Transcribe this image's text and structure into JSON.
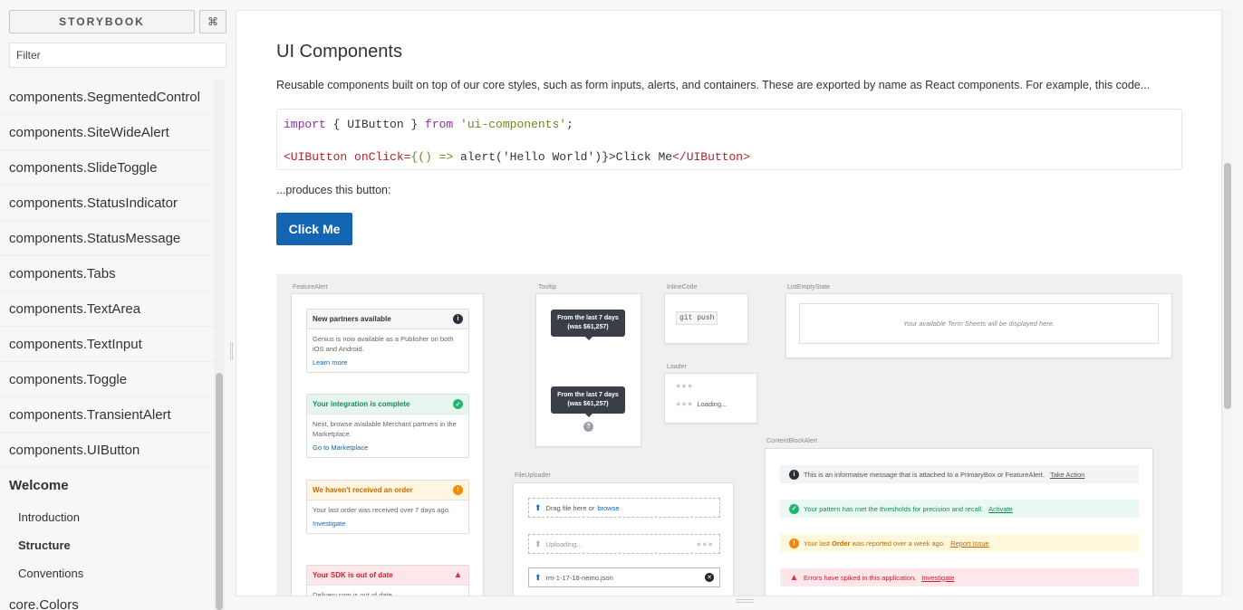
{
  "sidebar": {
    "title": "STORYBOOK",
    "shortcut_icon": "⌘",
    "filter_placeholder": "Filter",
    "components": [
      "components.SegmentedControl",
      "components.SiteWideAlert",
      "components.SlideToggle",
      "components.StatusIndicator",
      "components.StatusMessage",
      "components.Tabs",
      "components.TextArea",
      "components.TextInput",
      "components.Toggle",
      "components.TransientAlert",
      "components.UIButton"
    ],
    "kind_welcome": "Welcome",
    "stories": [
      "Introduction",
      "Structure",
      "Conventions"
    ],
    "active_story": "Structure",
    "kind_next": "core.Colors"
  },
  "main": {
    "title": "UI Components",
    "description": "Reusable components built on top of our core styles, such as form inputs, alerts, and containers. These are exported by name as React components. For example, this code...",
    "code": {
      "line1_kw1": "import",
      "line1_mid": " { UIButton } ",
      "line1_kw2": "from",
      "line1_str": " 'ui-components'",
      "line1_end": ";",
      "line2_tag_open": "<UIButton",
      "line2_attr": " onClick=",
      "line2_brace": "{() => ",
      "line2_body": "alert('Hello World')}",
      "line2_close": ">Click Me",
      "line2_tag_close": "</UIButton>"
    },
    "produces": "...produces this button:",
    "button_label": "Click Me"
  },
  "gallery": {
    "feature_alert_label": "FeatureAlert",
    "feature_alerts": [
      {
        "title": "New partners available",
        "body": "Genius is now available as a Publisher on both iOS and Android.",
        "link": "Learn more",
        "color": "#333333",
        "bg": "#f5f6f7",
        "icon": "info-icon",
        "glyph": "i",
        "icon_color": "#2b2f36"
      },
      {
        "title": "Your integration is complete",
        "body": "Next, browse available Merchant partners in the Marketplace.",
        "link": "Go to Marketplace",
        "color": "#1a8a5a",
        "bg": "#e6f6ef",
        "icon": "check-icon",
        "glyph": "✓",
        "icon_color": "#21b573"
      },
      {
        "title": "We haven't received an order",
        "body": "Your last order was received over 7 days ago.",
        "link": "Investigate",
        "color": "#c46a00",
        "bg": "#fff5e0",
        "icon": "warning-circle-icon",
        "glyph": "!",
        "icon_color": "#f58a07"
      },
      {
        "title": "Your SDK is out of date",
        "body": "Delivery.com is out of date",
        "link": "",
        "color": "#c8202e",
        "bg": "#fde7ea",
        "icon": "warning-triangle-icon",
        "glyph": "!",
        "icon_color": "#e0303d"
      }
    ],
    "tooltip_label": "Tooltip",
    "tooltip_line1": "From the last 7 days",
    "tooltip_line2": "(was $61,257)",
    "inline_code_label": "InlineCode",
    "inline_code_text": "git push",
    "loader_label": "Loader",
    "loader_text": "Loading...",
    "list_empty_label": "ListEmptyState",
    "list_empty_text": "Your available Term Sheets will be displayed here.",
    "file_uploader_label": "FileUploader",
    "file_drag": "Drag file here or",
    "file_browse": "browse",
    "file_uploading": "Uploading...",
    "file_name": "rm-1-17-18-nemo.json",
    "content_block_label": "ContentBlockAlert",
    "content_blocks": [
      {
        "pre": "This is an informative message that is attached to a PrimaryBox or FeatureAlert.",
        "bold": "",
        "post": "",
        "link": "Take Action",
        "bg": "#f2f3f5",
        "color": "#555555",
        "icon_color": "#2b2f36",
        "glyph": "i",
        "icon": "info-icon"
      },
      {
        "pre": "Your pattern has met the thresholds for precision and recall.",
        "bold": "",
        "post": "",
        "link": "Activate",
        "bg": "#e9f8f1",
        "color": "#1a8a5a",
        "icon_color": "#21b573",
        "glyph": "✓",
        "icon": "check-icon"
      },
      {
        "pre": "Your last ",
        "bold": "Order",
        "post": " was reported over a week ago.",
        "link": "Report Issue",
        "bg": "#fff8dc",
        "color": "#c46a00",
        "icon_color": "#f58a07",
        "glyph": "!",
        "icon": "warning-circle-icon"
      },
      {
        "pre": "Errors have spiked in this application.",
        "bold": "",
        "post": "",
        "link": "Investigate",
        "bg": "#fde7ea",
        "color": "#c8202e",
        "icon_color": "#e0303d",
        "glyph": "!",
        "icon": "warning-triangle-icon"
      }
    ]
  },
  "colors": {
    "primary": "#1464b4"
  }
}
